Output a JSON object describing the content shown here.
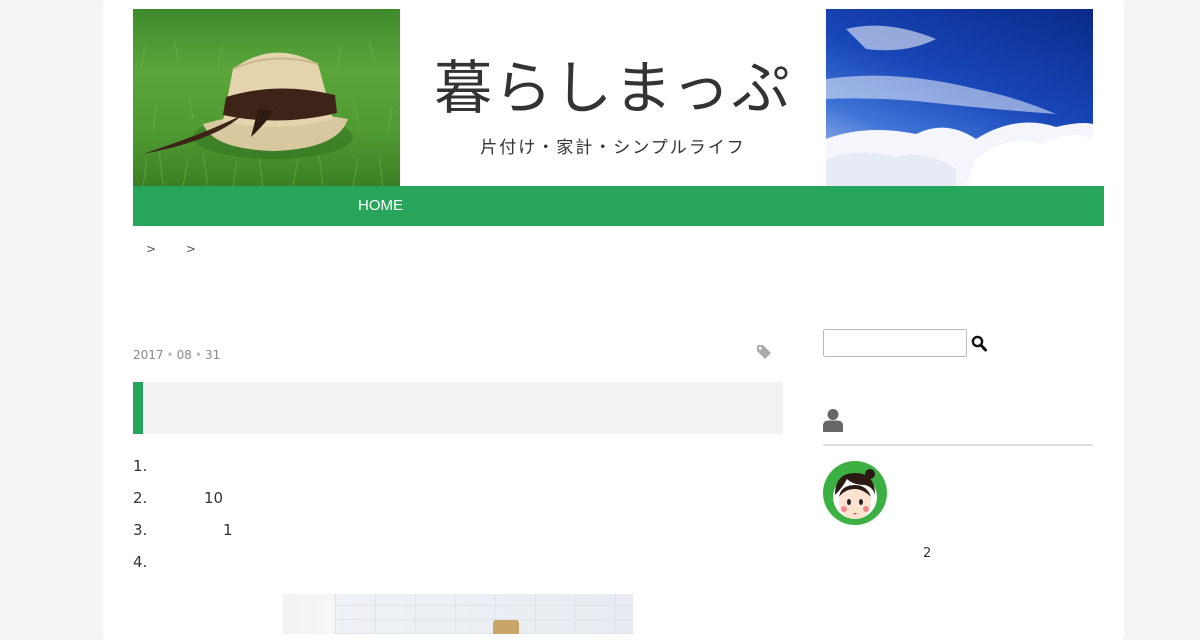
{
  "header": {
    "title": "暮らしまっぷ",
    "subtitle": "片付け・家計・シンプルライフ"
  },
  "nav": {
    "items": [
      {
        "label": "HOME"
      }
    ]
  },
  "breadcrumb": {
    "separators": [
      ">",
      ">"
    ]
  },
  "post": {
    "date": {
      "year": "2017",
      "month": "08",
      "day": "31",
      "separator": "•"
    },
    "toc": [
      {
        "number": "1.",
        "text": ""
      },
      {
        "number": "2.",
        "text": "10"
      },
      {
        "number": "3.",
        "text": "1"
      },
      {
        "number": "4.",
        "text": ""
      }
    ]
  },
  "sidebar": {
    "search": {
      "placeholder": ""
    },
    "profile_text": "2"
  },
  "colors": {
    "accent": "#27a55a",
    "title_box": "#f2f2f2",
    "page_bg": "#f4f4f4"
  },
  "icons": [
    "search-icon",
    "tag-icon",
    "user-icon"
  ]
}
